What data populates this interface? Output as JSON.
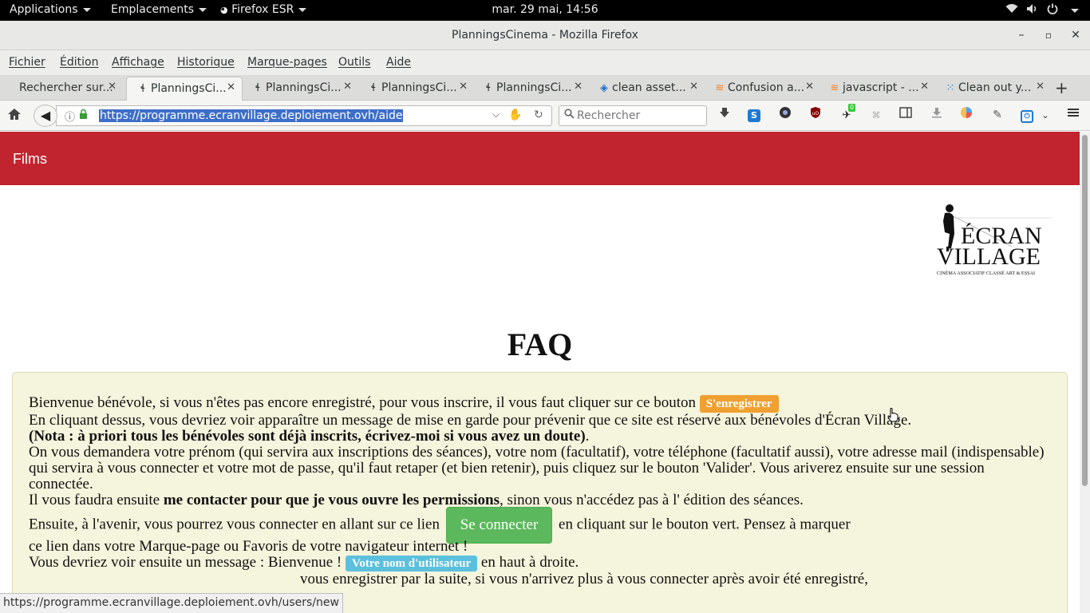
{
  "system_bar": {
    "applications": "Applications",
    "places": "Emplacements",
    "active_app": "Firefox ESR",
    "clock": "mar. 29 mai, 14:56"
  },
  "window": {
    "title": "PlanningsCinema - Mozilla Firefox",
    "min": "–",
    "max": "▫",
    "close": "✕"
  },
  "menu": [
    "Fichier",
    "Édition",
    "Affichage",
    "Historique",
    "Marque-pages",
    "Outils",
    "Aide"
  ],
  "tabs": [
    {
      "label": "Rechercher sur...",
      "icon": "none"
    },
    {
      "label": "PlanningsCi...",
      "icon": "ecran-village-icon",
      "active": true
    },
    {
      "label": "PlanningsCi...",
      "icon": "ecran-village-icon"
    },
    {
      "label": "PlanningsCi...",
      "icon": "ecran-village-icon"
    },
    {
      "label": "PlanningsCi...",
      "icon": "ecran-village-icon"
    },
    {
      "label": "clean asset...",
      "icon": "drop-icon"
    },
    {
      "label": "Confusion a...",
      "icon": "stackoverflow-icon"
    },
    {
      "label": "javascript - ...",
      "icon": "stackoverflow-icon"
    },
    {
      "label": "Clean out y...",
      "icon": "dots-icon"
    }
  ],
  "navbar": {
    "url": "https://programme.ecranvillage.deploiement.ovh/aide",
    "search_placeholder": "Rechercher",
    "badge_count": "0"
  },
  "site": {
    "brand": "Films",
    "logo_line1": "ÉCRAN",
    "logo_line2": "VILLAGE",
    "logo_tagline": "CINÉMA ASSOCIATIF CLASSÉ ART & ESSAI"
  },
  "faq": {
    "title": "FAQ",
    "p1_before": "Bienvenue bénévole, si vous n'êtes pas encore enregistré, pour vous inscrire, il vous faut cliquer sur ce bouton",
    "register_label": "S'enregistrer",
    "p2": "En cliquant dessus, vous devriez voir apparaître un message de mise en garde pour prévenir que ce site est réservé aux bénévoles d'Écran Village.",
    "p3_bold": "(Nota : à priori tous les bénévoles sont déjà inscrits, écrivez-moi si vous avez un doute)",
    "p3_after": ".",
    "p4": "On vous demandera votre prénom (qui servira aux inscriptions des séances), votre nom (facultatif), votre téléphone (facultatif aussi), votre adresse mail (indispensable) qui servira à vous connecter et votre mot de passe, qu'il faut retaper (et bien retenir), puis cliquez sur le bouton 'Valider'. Vous ariverez ensuite sur une session connectée.",
    "p5_before": "Il vous faudra ensuite",
    "p5_bold": "me contacter pour que je vous ouvre les permissions",
    "p5_after": ", sinon vous n'accédez pas à l' édition des séances.",
    "p6_before": "Ensuite, à l'avenir, vous pourrez vous connecter en allant sur ce lien",
    "login_label": "Se connecter",
    "p6_after": "en cliquant sur le bouton vert. Pensez à marquer",
    "p6_line2": "ce lien dans votre Marque-page ou Favoris de votre navigateur internet !",
    "p7_before": "Vous devriez voir ensuite un message : Bienvenue !",
    "username_label": "Votre nom d'utilisateur",
    "p7_after": "en haut à droite.",
    "p8": "vous enregistrer par la suite, si vous n'arrivez plus à vous connecter après avoir été enregistré,"
  },
  "status": {
    "link": "https://programme.ecranvillage.deploiement.ovh/users/new"
  },
  "colors": {
    "header": "#c2242f",
    "faq_bg": "#f5f4dc",
    "register": "#f0a031",
    "login": "#5cb85c",
    "username": "#5bc0de"
  }
}
